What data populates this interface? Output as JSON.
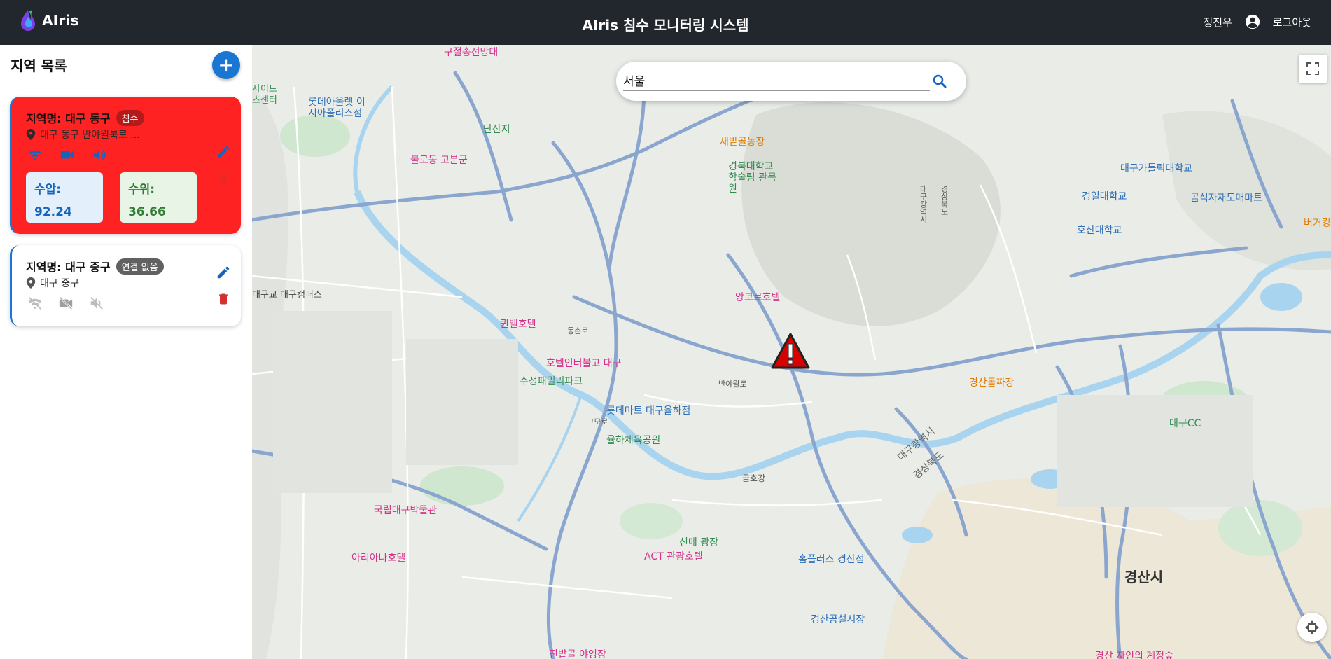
{
  "header": {
    "brand": "AIris",
    "title": "AIris 침수 모니터링 시스템",
    "user_name": "정진우",
    "logout_label": "로그아웃"
  },
  "sidebar": {
    "title": "지역 목록",
    "add_label": "+",
    "regions": [
      {
        "name": "지역명: 대구 동구",
        "status": "침수",
        "address": "대구 동구 반야월북로 ...",
        "pressure_label": "수압:",
        "pressure_value": "92.24",
        "level_label": "수위:",
        "level_value": "36.66"
      },
      {
        "name": "지역명: 대구 중구",
        "status": "연결 없음",
        "address": "대구 중구"
      }
    ]
  },
  "search": {
    "value": "서울",
    "placeholder": ""
  },
  "map": {
    "labels": [
      "구절송전망대",
      "롯데아울렛 이시아폴리스점",
      "단산지",
      "불로동 고분군",
      "새밭골농장",
      "경북대학교 학술림 관목원",
      "대구광역시",
      "경상북도",
      "대구가톨릭대학교",
      "경일대학교",
      "호산대학교",
      "곰식자재도매마트",
      "버거킹",
      "앙코르호텔",
      "퀸벨호텔",
      "호텔인터불고 대구",
      "수성패밀리파크",
      "롯데마트 대구율하점",
      "율하체육공원",
      "경산돌짜장",
      "대구CC",
      "대구광역시",
      "경상북도",
      "국립대구박물관",
      "아리아나호텔",
      "신매 광장",
      "ACT 관광호텔",
      "홈플러스 경산점",
      "경산공설시장",
      "경산시",
      "진밭골 야영장",
      "경산 자인의 계정숲",
      "대구교 대구캠퍼스",
      "사이드 츠센터",
      "금호강",
      "반야월로",
      "고모로",
      "동촌로"
    ]
  },
  "colors": {
    "alert": "#ff2222",
    "accent": "#1976d2",
    "topbar": "#22272e",
    "delete": "#d32f2f"
  }
}
